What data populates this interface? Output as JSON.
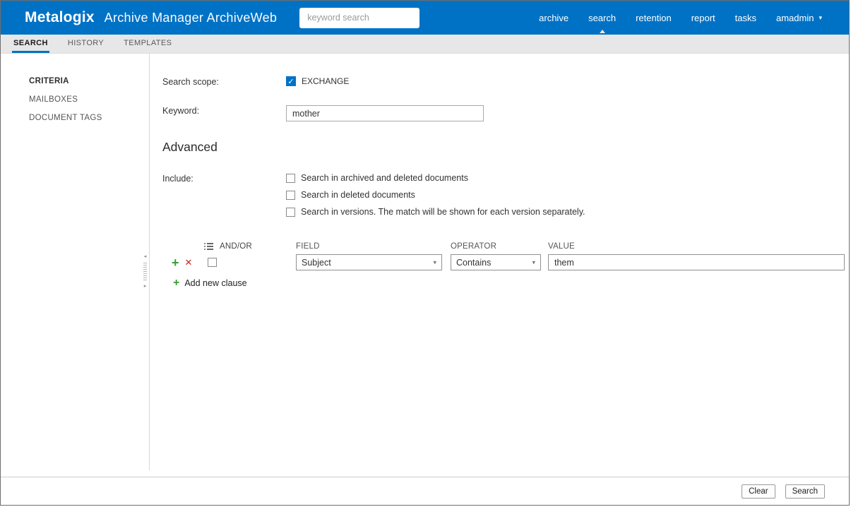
{
  "header": {
    "logo": "Metalogix",
    "app_title": "Archive Manager ArchiveWeb",
    "search_placeholder": "keyword search",
    "nav": [
      {
        "label": "archive",
        "active": false
      },
      {
        "label": "search",
        "active": true
      },
      {
        "label": "retention",
        "active": false
      },
      {
        "label": "report",
        "active": false
      },
      {
        "label": "tasks",
        "active": false
      }
    ],
    "user_menu": "amadmin"
  },
  "tabs": [
    {
      "label": "SEARCH",
      "active": true
    },
    {
      "label": "HISTORY",
      "active": false
    },
    {
      "label": "TEMPLATES",
      "active": false
    }
  ],
  "sidebar": {
    "items": [
      {
        "label": "CRITERIA",
        "active": true
      },
      {
        "label": "MAILBOXES",
        "active": false
      },
      {
        "label": "DOCUMENT TAGS",
        "active": false
      }
    ]
  },
  "form": {
    "search_scope_label": "Search scope:",
    "exchange_checkbox": {
      "label": "EXCHANGE",
      "checked": true
    },
    "keyword_label": "Keyword:",
    "keyword_value": "mother",
    "advanced_heading": "Advanced",
    "include_label": "Include:",
    "include_options": [
      {
        "label": "Search in archived and deleted documents",
        "checked": false
      },
      {
        "label": "Search in deleted documents",
        "checked": false
      },
      {
        "label": "Search in versions. The match will be shown for each version separately.",
        "checked": false
      }
    ]
  },
  "clause_builder": {
    "and_or_label": "AND/OR",
    "field_label": "FIELD",
    "operator_label": "OPERATOR",
    "value_label": "VALUE",
    "field_value": "Subject",
    "operator_value": "Contains",
    "value_value": "them",
    "row_checked": false,
    "add_new_clause_label": "Add new clause"
  },
  "footer": {
    "clear_label": "Clear",
    "search_label": "Search"
  },
  "colors": {
    "header_blue": "#0072c6",
    "accent_blue": "#0072c6",
    "add_green": "#3a9c35",
    "remove_red": "#cc2222"
  }
}
